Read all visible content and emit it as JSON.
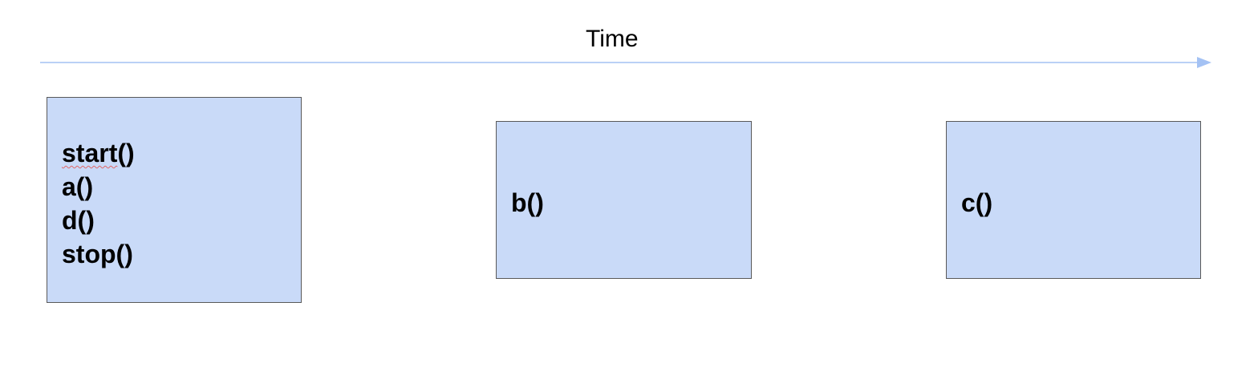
{
  "timeline": {
    "label": "Time",
    "line_color": "#a4c2f4"
  },
  "box_fill": "#c9daf8",
  "box_border": "#595959",
  "boxes": [
    {
      "lines": [
        {
          "word": "start",
          "suffix": "()",
          "spellcheck": true
        },
        {
          "text": "a()"
        },
        {
          "text": "d()"
        },
        {
          "text": "stop()"
        }
      ]
    },
    {
      "lines": [
        {
          "text": "b()"
        }
      ]
    },
    {
      "lines": [
        {
          "text": "c()"
        }
      ]
    }
  ]
}
